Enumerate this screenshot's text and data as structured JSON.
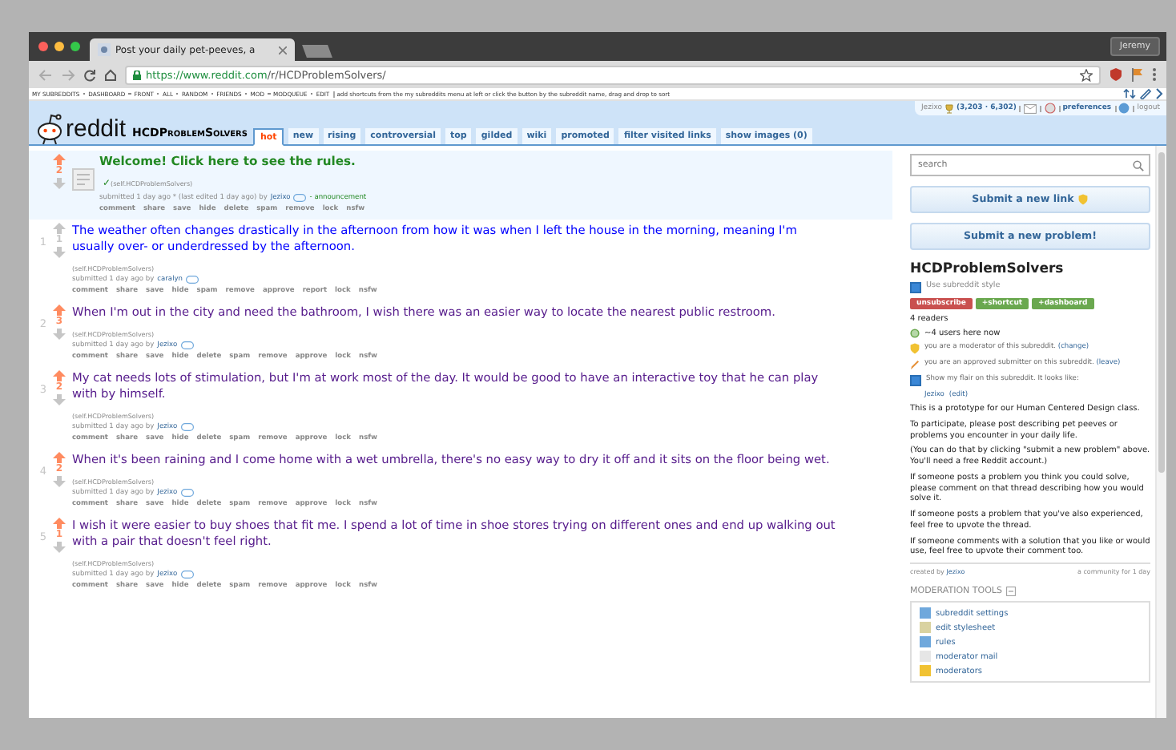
{
  "browser": {
    "tab_title": "Post your daily pet-peeves, a",
    "profile": "Jeremy",
    "url_host": "https://www.reddit.com",
    "url_path": "/r/HCDProblemSolvers/"
  },
  "sr_bar": {
    "items": [
      "MY SUBREDDITS",
      "DASHBOARD",
      "FRONT",
      "ALL",
      "RANDOM",
      "FRIENDS",
      "MOD",
      "MODQUEUE",
      "EDIT"
    ],
    "hint": "add shortcuts from the my subreddits menu at left or click the button by the subreddit name, drag and drop to sort"
  },
  "header": {
    "logo": "reddit",
    "subreddit": "HCDProblemSolvers",
    "tabs": [
      {
        "label": "hot",
        "selected": true
      },
      {
        "label": "new",
        "selected": false
      },
      {
        "label": "rising",
        "selected": false
      },
      {
        "label": "controversial",
        "selected": false
      },
      {
        "label": "top",
        "selected": false
      },
      {
        "label": "gilded",
        "selected": false
      },
      {
        "label": "wiki",
        "selected": false
      },
      {
        "label": "promoted",
        "selected": false
      },
      {
        "label": "filter visited links",
        "selected": false
      },
      {
        "label": "show images (0)",
        "selected": false
      }
    ],
    "user": "Jezixo",
    "karma": "(3,203 · 6,302)",
    "preferences": "preferences",
    "logout": "logout"
  },
  "posts": [
    {
      "kind": "announcement",
      "score": "2",
      "upvoted": true,
      "title": "Welcome! Click here to see the rules.",
      "mark": "✓",
      "domain": "(self.HCDProblemSolvers)",
      "tagline_pre": "submitted 1 day ago * (last edited 1 day ago) by",
      "author": "Jezixo",
      "tagline_post": "- announcement",
      "actions": [
        "comment",
        "share",
        "save",
        "hide",
        "delete",
        "spam",
        "remove",
        "lock",
        "nsfw"
      ]
    },
    {
      "kind": "link",
      "rank": "1",
      "score": "1",
      "upvoted": false,
      "title": "The weather often changes drastically in the afternoon from how it was when I left the house in the morning, meaning I'm usually over- or underdressed by the afternoon.",
      "domain": "(self.HCDProblemSolvers)",
      "tagline_pre": "submitted 1 day ago by",
      "author": "caralyn",
      "actions": [
        "comment",
        "share",
        "save",
        "hide",
        "spam",
        "remove",
        "approve",
        "report",
        "lock",
        "nsfw"
      ]
    },
    {
      "kind": "link",
      "rank": "2",
      "score": "3",
      "upvoted": true,
      "title": "When I'm out in the city and need the bathroom, I wish there was an easier way to locate the nearest public restroom.",
      "domain": "(self.HCDProblemSolvers)",
      "tagline_pre": "submitted 1 day ago by",
      "author": "Jezixo",
      "actions": [
        "comment",
        "share",
        "save",
        "hide",
        "delete",
        "spam",
        "remove",
        "approve",
        "lock",
        "nsfw"
      ]
    },
    {
      "kind": "link",
      "rank": "3",
      "score": "2",
      "upvoted": true,
      "title": "My cat needs lots of stimulation, but I'm at work most of the day. It would be good to have an interactive toy that he can play with by himself.",
      "domain": "(self.HCDProblemSolvers)",
      "tagline_pre": "submitted 1 day ago by",
      "author": "Jezixo",
      "actions": [
        "comment",
        "share",
        "save",
        "hide",
        "delete",
        "spam",
        "remove",
        "approve",
        "lock",
        "nsfw"
      ]
    },
    {
      "kind": "link",
      "rank": "4",
      "score": "2",
      "upvoted": true,
      "title": "When it's been raining and I come home with a wet umbrella, there's no easy way to dry it off and it sits on the floor being wet.",
      "domain": "(self.HCDProblemSolvers)",
      "tagline_pre": "submitted 1 day ago by",
      "author": "Jezixo",
      "actions": [
        "comment",
        "share",
        "save",
        "hide",
        "delete",
        "spam",
        "remove",
        "approve",
        "lock",
        "nsfw"
      ]
    },
    {
      "kind": "link",
      "rank": "5",
      "score": "1",
      "upvoted": true,
      "title": "I wish it were easier to buy shoes that fit me. I spend a lot of time in shoe stores trying on different ones and end up walking out with a pair that doesn't feel right.",
      "domain": "(self.HCDProblemSolvers)",
      "tagline_pre": "submitted 1 day ago by",
      "author": "Jezixo",
      "actions": [
        "comment",
        "share",
        "save",
        "hide",
        "delete",
        "spam",
        "remove",
        "approve",
        "lock",
        "nsfw"
      ]
    }
  ],
  "sidebar": {
    "search": {
      "placeholder": "search"
    },
    "submit_buttons": [
      "Submit a new link",
      "Submit a new problem!"
    ],
    "title": "HCDProblemSolvers",
    "style_checkbox": {
      "label": "Use subreddit style",
      "checked": true
    },
    "sub_buttons": [
      {
        "label": "unsubscribe",
        "color": "#c9504f"
      },
      {
        "label": "+shortcut",
        "color": "#6aa84f"
      },
      {
        "label": "+dashboard",
        "color": "#6aa84f"
      }
    ],
    "readers": "4 readers",
    "online": "~4 users here now",
    "moderator": {
      "text": "you are a moderator of this subreddit.",
      "link": "(change)"
    },
    "approved": {
      "text": "you are an approved submitter on this subreddit.",
      "link": "(leave)"
    },
    "flair_checkbox": {
      "label": "Show my flair on this subreddit. It looks like:",
      "checked": true
    },
    "flair_user": "Jezixo",
    "flair_edit": "(edit)",
    "paragraphs": [
      "This is a prototype for our Human Centered Design class.",
      "To participate, please post describing pet peeves or problems you encounter in your daily life.",
      "(You can do that by clicking \"submit a new problem\" above. You'll need a free Reddit account.)",
      "If someone posts a problem you think you could solve, please comment on that thread describing how you would solve it.",
      "If someone posts a problem that you've also experienced, feel free to upvote the thread.",
      "If someone comments with a solution that you like or would use, feel free to upvote their comment too."
    ],
    "created_pre": "created by",
    "created_user": "Jezixo",
    "age": "a community for 1 day",
    "mod_tools_title": "MODERATION TOOLS",
    "mod_tools": [
      "subreddit settings",
      "edit stylesheet",
      "rules",
      "moderator mail",
      "moderators"
    ]
  }
}
